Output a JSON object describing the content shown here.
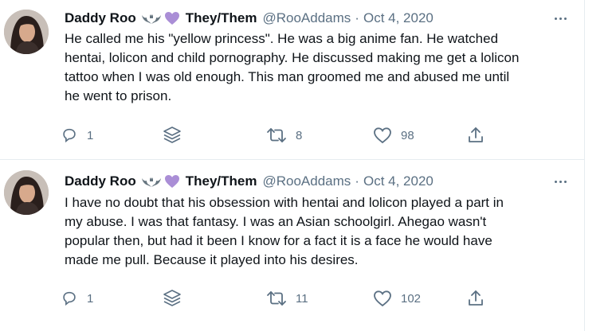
{
  "tweets": [
    {
      "author_name": "Daddy Roo",
      "pronouns": "They/Them",
      "handle": "@RooAddams",
      "separator": "·",
      "date": "Oct 4, 2020",
      "text_lines": [
        "He called me his \"yellow princess\". He was a big anime fan. He watched",
        "hentai, lolicon and child pornography. He discussed making me get a lolicon",
        "tattoo when I was old enough. This man groomed me and abused me until",
        "he went to prison."
      ],
      "reply_count": "1",
      "retweet_count": "8",
      "like_count": "98"
    },
    {
      "author_name": "Daddy Roo",
      "pronouns": "They/Them",
      "handle": "@RooAddams",
      "separator": "·",
      "date": "Oct 4, 2020",
      "text_lines": [
        "I have no doubt that his obsession with hentai and lolicon played a part in",
        "my abuse. I was that fantasy. I was an Asian schoolgirl.  Ahegao wasn't",
        "popular then, but had it been I know for a fact it is a face he would have",
        "made me pull. Because it played into his desires."
      ],
      "reply_count": "1",
      "retweet_count": "11",
      "like_count": "102"
    }
  ],
  "icons": {
    "name_emoji_1": "bat-emoji-icon",
    "name_emoji_2": "purple-heart-emoji-icon",
    "more": "more-dots-icon",
    "reply": "reply-bubble-icon",
    "stack": "stack-layers-icon",
    "retweet": "retweet-icon",
    "like": "heart-outline-icon",
    "share": "share-upload-icon"
  },
  "colors": {
    "text": "#0f1419",
    "secondary": "#5b7083",
    "border": "#e6ecf0",
    "heart_emoji": "#aa8ed6"
  }
}
